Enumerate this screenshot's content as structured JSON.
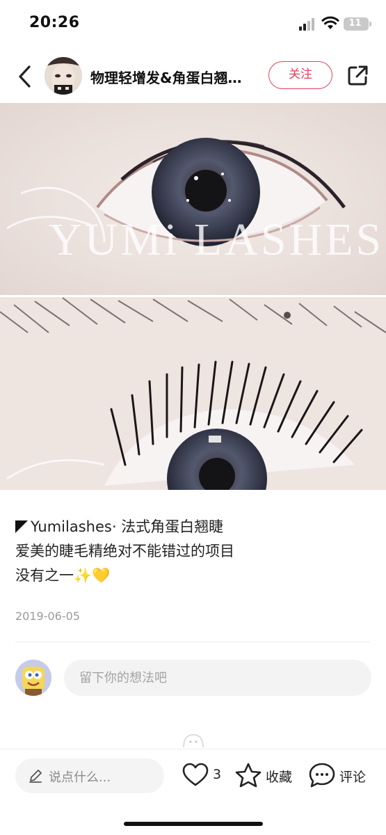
{
  "status_bar": {
    "time": "20:26",
    "battery_level": "11",
    "icons": [
      "cellular-signal-icon",
      "wifi-icon",
      "battery-icon"
    ]
  },
  "header": {
    "author_name": "物理轻增发&角蛋白翘…",
    "follow_label": "关注",
    "icons": [
      "back-icon",
      "share-icon"
    ]
  },
  "post": {
    "photo_watermark": "YUMi LASHES",
    "caption_lines": [
      "Yumilashes· 法式角蛋白翘睫",
      "爱美的睫毛精绝对不能错过的项目",
      "没有之一✨💛"
    ],
    "date": "2019-06-05"
  },
  "comment_box": {
    "placeholder": "留下你的想法吧"
  },
  "bottom_bar": {
    "input_placeholder": "说点什么...",
    "like_count": "3",
    "collect_label": "收藏",
    "comment_label": "评论",
    "icons": [
      "pencil-icon",
      "heart-icon",
      "star-icon",
      "chat-bubble-icon"
    ]
  },
  "colors": {
    "accent": "#e4405a",
    "text": "#222222",
    "muted": "#9a9a9a",
    "input_bg": "#f3f3f3"
  }
}
